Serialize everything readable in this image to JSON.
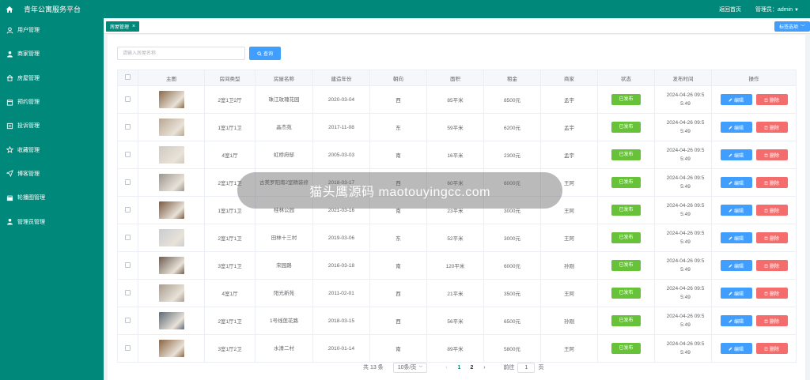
{
  "app": {
    "title": "青年公寓服务平台"
  },
  "header": {
    "home_link": "返回首页",
    "admin_label": "管理员：admin"
  },
  "sidebar": {
    "items": [
      {
        "label": "用户管理",
        "icon": "user-icon"
      },
      {
        "label": "商家管理",
        "icon": "merchant-icon"
      },
      {
        "label": "房屋管理",
        "icon": "house-icon"
      },
      {
        "label": "预约管理",
        "icon": "calendar-icon"
      },
      {
        "label": "投诉管理",
        "icon": "complaint-icon"
      },
      {
        "label": "收藏管理",
        "icon": "star-icon"
      },
      {
        "label": "博客管理",
        "icon": "send-icon"
      },
      {
        "label": "轮播图管理",
        "icon": "carousel-icon"
      },
      {
        "label": "管理员管理",
        "icon": "admin-icon"
      }
    ]
  },
  "tabs": {
    "active_label": "房屋管理",
    "close_symbol": "×",
    "options_label": "标签选项"
  },
  "search": {
    "placeholder": "请输入房屋名称",
    "button_label": "查询"
  },
  "table": {
    "headers": [
      "",
      "主图",
      "房间类型",
      "房屋名称",
      "建造年份",
      "朝向",
      "面积",
      "租金",
      "商家",
      "状态",
      "发布时间",
      "操作"
    ],
    "edit_label": "编辑",
    "delete_label": "删除",
    "rows": [
      {
        "type": "2室1卫2厅",
        "name": "珠江玫瑰花园",
        "year": "2020-03-04",
        "orient": "西",
        "area": "85平米",
        "rent": "8500元",
        "merchant": "孟宇",
        "status": "已发布",
        "time1": "2024-04-26 09:5",
        "time2": "5:49",
        "thumb": "#8a6a4a"
      },
      {
        "type": "1室1厅1卫",
        "name": "晶杰苑",
        "year": "2017-11-08",
        "orient": "东",
        "area": "59平米",
        "rent": "6200元",
        "merchant": "孟宇",
        "status": "已发布",
        "time1": "2024-04-26 09:5",
        "time2": "5:49",
        "thumb": "#b9a792"
      },
      {
        "type": "4室1厅",
        "name": "虹桥府邸",
        "year": "2005-03-03",
        "orient": "南",
        "area": "16平米",
        "rent": "2300元",
        "merchant": "孟宇",
        "status": "已发布",
        "time1": "2024-04-26 09:5",
        "time2": "5:49",
        "thumb": "#cfcac2"
      },
      {
        "type": "2室1厅1卫",
        "name": "古美罗阳南2室精装修",
        "year": "2018-03-17",
        "orient": "西",
        "area": "60平米",
        "rent": "6000元",
        "merchant": "王阿",
        "status": "已发布",
        "time1": "2024-04-26 09:5",
        "time2": "5:49",
        "thumb": "#9a9590"
      },
      {
        "type": "1室1厅1卫",
        "name": "桂林公园",
        "year": "2021-03-16",
        "orient": "南",
        "area": "23平米",
        "rent": "3000元",
        "merchant": "王阿",
        "status": "已发布",
        "time1": "2024-04-26 09:5",
        "time2": "5:49",
        "thumb": "#7a5a42"
      },
      {
        "type": "2室1厅1卫",
        "name": "田林十三村",
        "year": "2019-03-06",
        "orient": "东",
        "area": "52平米",
        "rent": "3000元",
        "merchant": "王阿",
        "status": "已发布",
        "time1": "2024-04-26 09:5",
        "time2": "5:49",
        "thumb": "#c8ccd2"
      },
      {
        "type": "3室1厅1卫",
        "name": "宋园路",
        "year": "2016-03-18",
        "orient": "南",
        "area": "120平米",
        "rent": "6000元",
        "merchant": "孙刚",
        "status": "已发布",
        "time1": "2024-04-26 09:5",
        "time2": "5:49",
        "thumb": "#6e5d50"
      },
      {
        "type": "4室1厅",
        "name": "阳光新苑",
        "year": "2011-02-01",
        "orient": "西",
        "area": "21平米",
        "rent": "3500元",
        "merchant": "王阿",
        "status": "已发布",
        "time1": "2024-04-26 09:5",
        "time2": "5:49",
        "thumb": "#a89c8e"
      },
      {
        "type": "2室1厅1卫",
        "name": "1号线莲花路",
        "year": "2018-03-15",
        "orient": "西",
        "area": "56平米",
        "rent": "6500元",
        "merchant": "孙刚",
        "status": "已发布",
        "time1": "2024-04-26 09:5",
        "time2": "5:49",
        "thumb": "#5e6a78"
      },
      {
        "type": "3室1厅2卫",
        "name": "水清二村",
        "year": "2010-01-14",
        "orient": "南",
        "area": "89平米",
        "rent": "5800元",
        "merchant": "王阿",
        "status": "已发布",
        "time1": "2024-04-26 09:5",
        "time2": "5:49",
        "thumb": "#8c6440"
      }
    ]
  },
  "pagination": {
    "total": "共 13 条",
    "page_size": "10条/页",
    "prev": "‹",
    "next": "›",
    "pages": [
      "1",
      "2"
    ],
    "current": "1",
    "goto_label": "前往",
    "goto_value": "1",
    "goto_unit": "页"
  },
  "overlay": {
    "text": "猫头鹰源码 maotouyingcc.com"
  },
  "colors": {
    "primary": "#00897b",
    "blue": "#409eff",
    "green": "#67c23a",
    "red": "#f56c6c"
  }
}
